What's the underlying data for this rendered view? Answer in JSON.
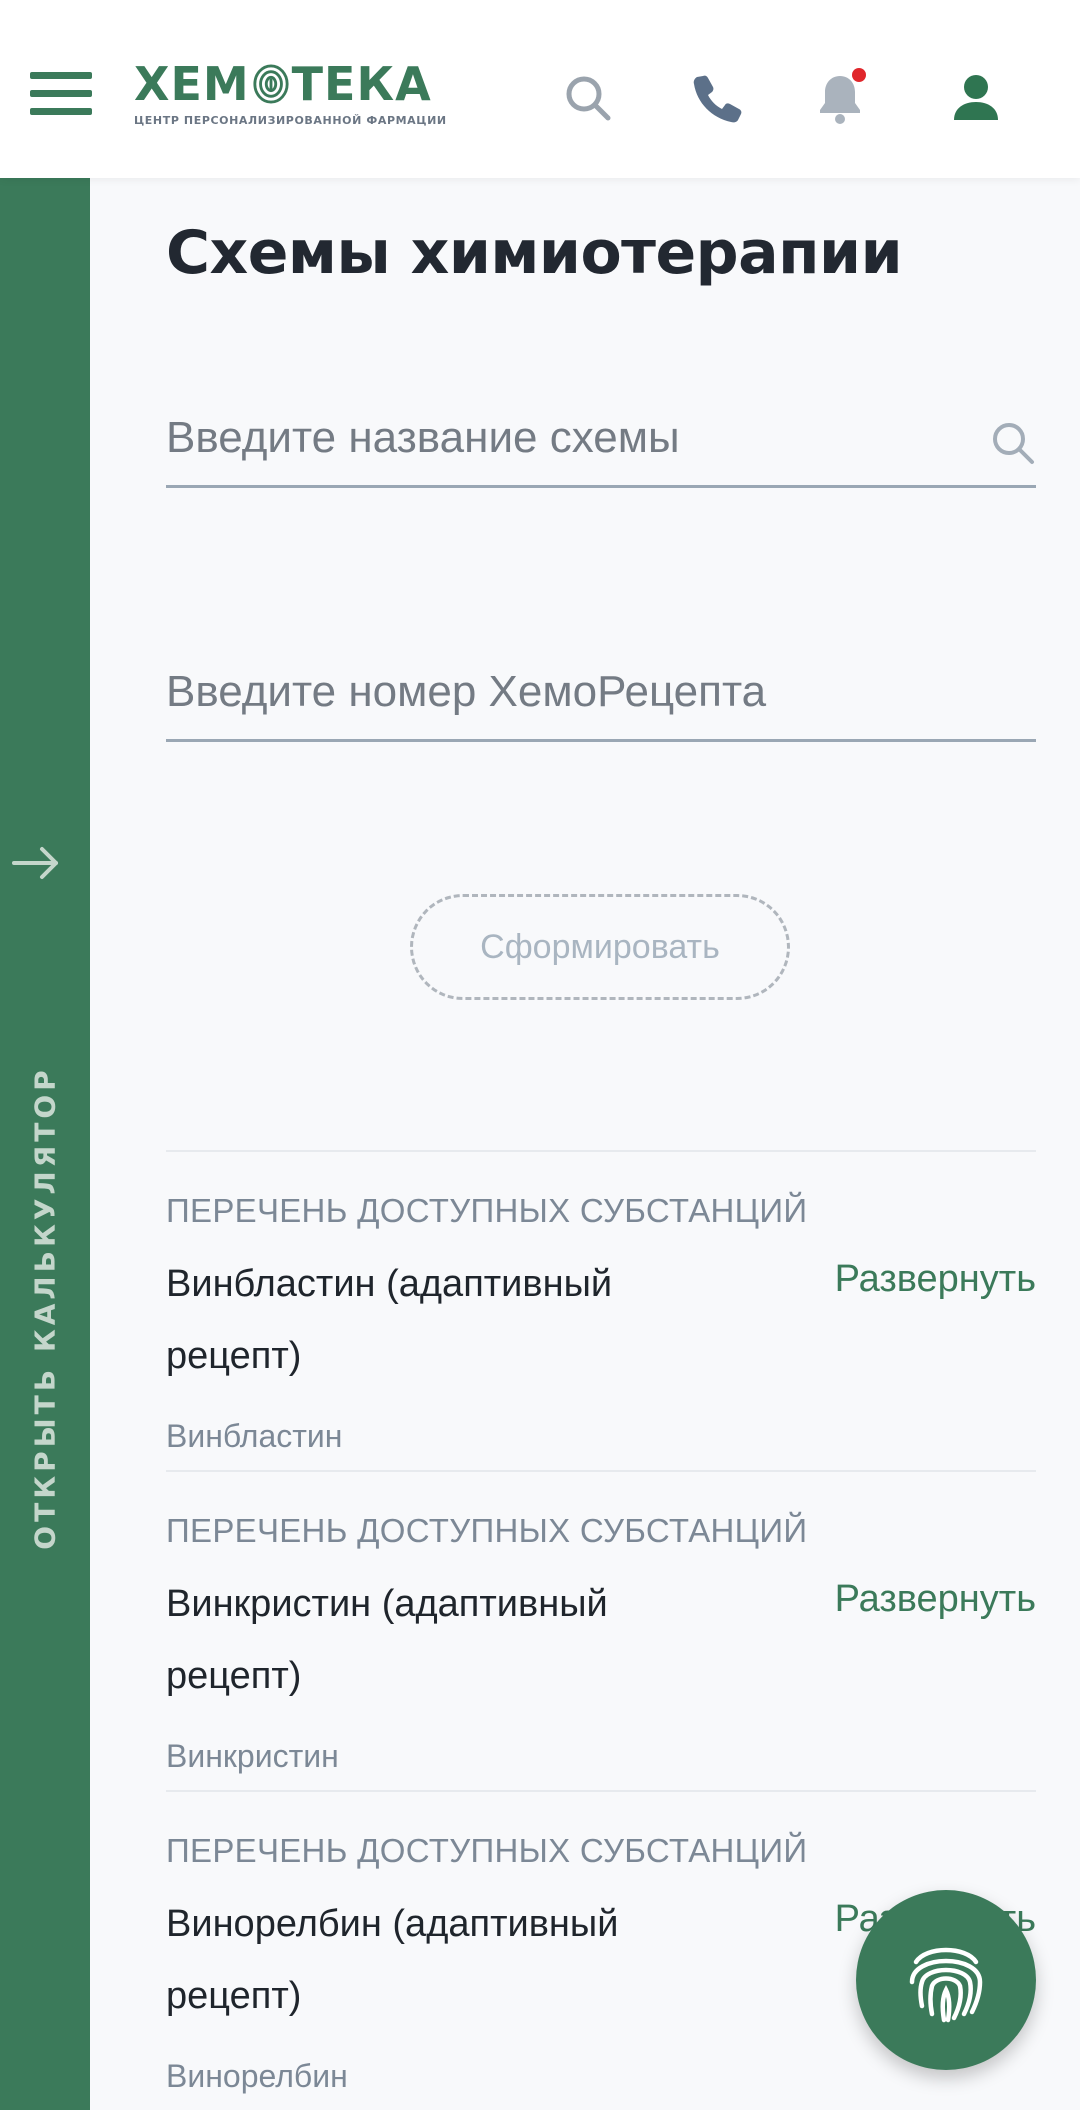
{
  "header": {
    "logo_text": "ХЕМОТЕКА",
    "logo_part1": "ХЕМ",
    "logo_part2": "ТЕКА",
    "logo_subtitle": "ЦЕНТР ПЕРСОНАЛИЗИРОВАННОЙ ФАРМАЦИИ",
    "icons": [
      "menu-icon",
      "search-icon",
      "phone-icon",
      "bell-icon",
      "user-icon"
    ],
    "notification_dot_color": "#e0262b"
  },
  "sidebar": {
    "label": "ОТКРЫТЬ КАЛЬКУЛЯТОР",
    "icon": "arrow-right-icon",
    "background_color": "#3b7a5a"
  },
  "page": {
    "title": "Схемы химиотерапии"
  },
  "search": {
    "scheme_placeholder": "Введите название схемы",
    "scheme_value": "",
    "recipe_placeholder": "Введите номер ХемоРецепта",
    "recipe_value": ""
  },
  "form_button_label": "Сформировать",
  "items": [
    {
      "category": "ПЕРЕЧЕНЬ ДОСТУПНЫХ СУБСТАНЦИЙ",
      "title": "Винбластин (адаптивный рецепт)",
      "expand": "Развернуть",
      "substance": "Винбластин"
    },
    {
      "category": "ПЕРЕЧЕНЬ ДОСТУПНЫХ СУБСТАНЦИЙ",
      "title": "Винкристин (адаптивный рецепт)",
      "expand": "Развернуть",
      "substance": "Винкристин"
    },
    {
      "category": "ПЕРЕЧЕНЬ ДОСТУПНЫХ СУБСТАНЦИЙ",
      "title": "Винорелбин (адаптивный рецепт)",
      "expand": "Развернуть",
      "substance": "Винорелбин"
    }
  ],
  "fab": {
    "icon": "fingerprint-icon"
  },
  "colors": {
    "brand_green": "#3b7a5a",
    "title_dark": "#222831",
    "muted": "#7c8896"
  }
}
